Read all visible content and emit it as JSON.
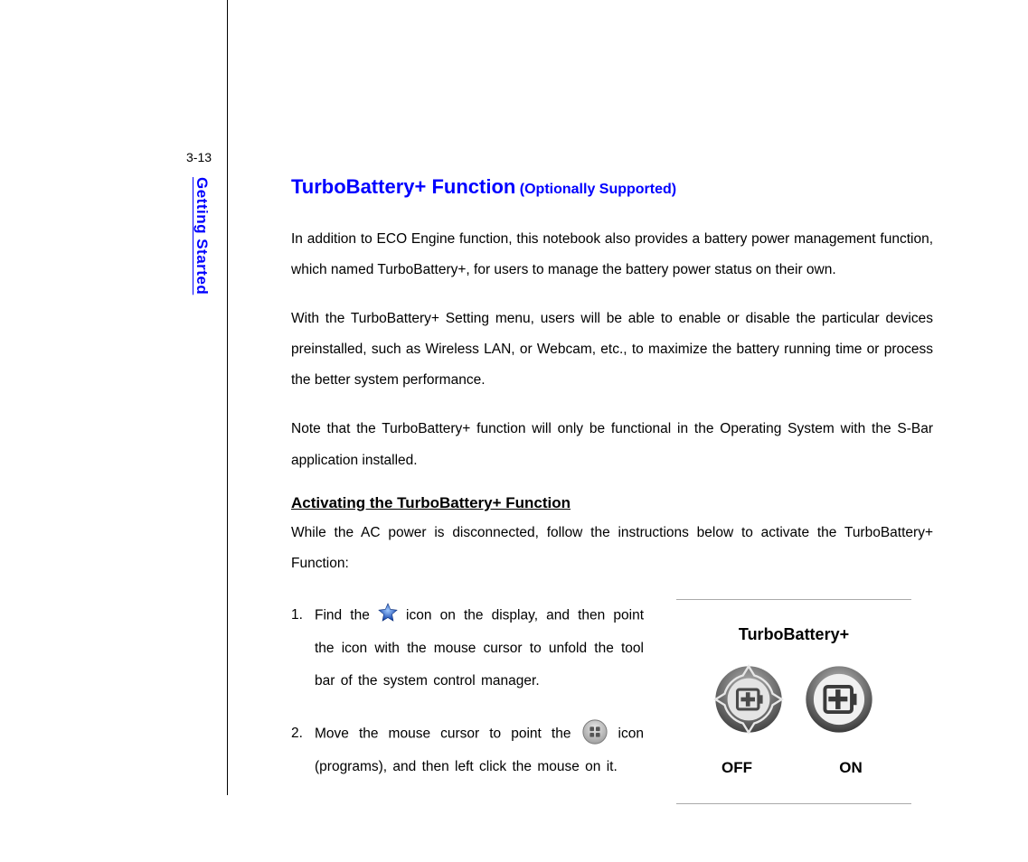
{
  "page_number": "3-13",
  "sidebar_label": "Getting Started",
  "title_main": "TurboBattery+ Function",
  "title_sub": "(Optionally Supported)",
  "para1": "In addition to ECO Engine function, this notebook also provides a battery power management function, which named TurboBattery+, for users to manage the battery power status on their own.",
  "para2": "With the TurboBattery+ Setting menu, users will be able to enable or disable the particular devices preinstalled, such as Wireless LAN, or Webcam, etc., to maximize the battery running time or process the better system performance.",
  "para3": "Note that the TurboBattery+ function will only be functional in the Operating System with the S-Bar application installed.",
  "subheading": "Activating the TurboBattery+ Function",
  "intro": "While the AC power is disconnected, follow the instructions below to activate the TurboBattery+ Function:",
  "step1_num": "1.",
  "step1_a": "Find the ",
  "step1_b": " icon on the display, and then point the icon with the mouse cursor to unfold the tool bar of the system control manager.",
  "step2_num": "2.",
  "step2_a": "Move the mouse cursor to point the ",
  "step2_b": " icon (programs), and then left click the mouse on it.",
  "widget": {
    "title": "TurboBattery+",
    "off": "OFF",
    "on": "ON"
  },
  "icons": {
    "star": "star-icon",
    "programs": "programs-icon",
    "tb_off": "turbobattery-off-icon",
    "tb_on": "turbobattery-on-icon"
  }
}
